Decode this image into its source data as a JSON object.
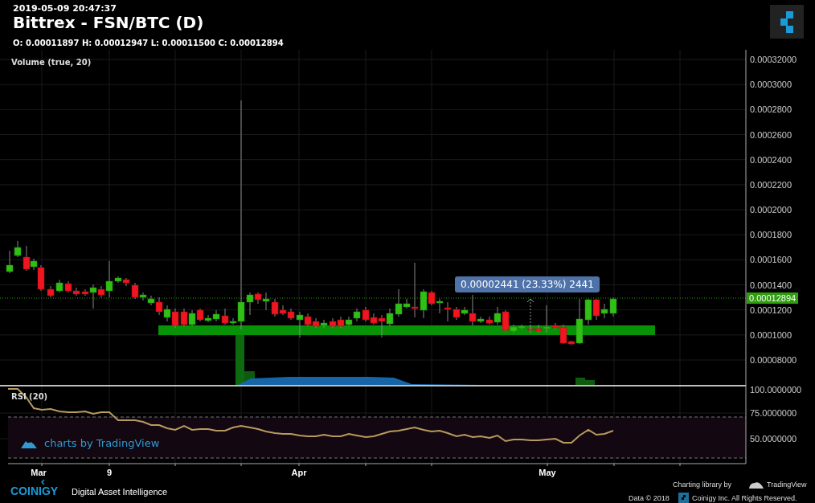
{
  "header": {
    "timestamp": "2019-05-09 20:47:37",
    "title": "Bittrex - FSN/BTC (D)",
    "ohlc": "O: 0.00011897 H: 0.00012947 L: 0.00011500 C: 0.00012894"
  },
  "price_pane": {
    "indicator": "Volume (true, 20)",
    "axis_labels": [
      "0.00032000",
      "0.0003000",
      "0.0002800",
      "0.0002600",
      "0.0002400",
      "0.0002200",
      "0.0002000",
      "0.0001800",
      "0.0001600",
      "0.0001400",
      "0.0001200",
      "0.0001000",
      "0.00008000"
    ],
    "current_price": "0.00012894",
    "tooltip": "0.00002441 (23.33%) 2441"
  },
  "rsi_pane": {
    "indicator": "RSI (20)",
    "axis_labels": [
      "100.0000000",
      "75.0000000",
      "50.0000000"
    ],
    "watermark": "charts by TradingView"
  },
  "time_axis": [
    "Mar",
    "9",
    "Apr",
    "May"
  ],
  "footer": {
    "brand": "COINIGY",
    "tagline": "Digital Asset Intelligence",
    "credit": "Charting library by",
    "credit_brand": "TradingView",
    "data_note": "Data © 2018",
    "rights": "Coinigy Inc. All Rights Reserved."
  }
}
